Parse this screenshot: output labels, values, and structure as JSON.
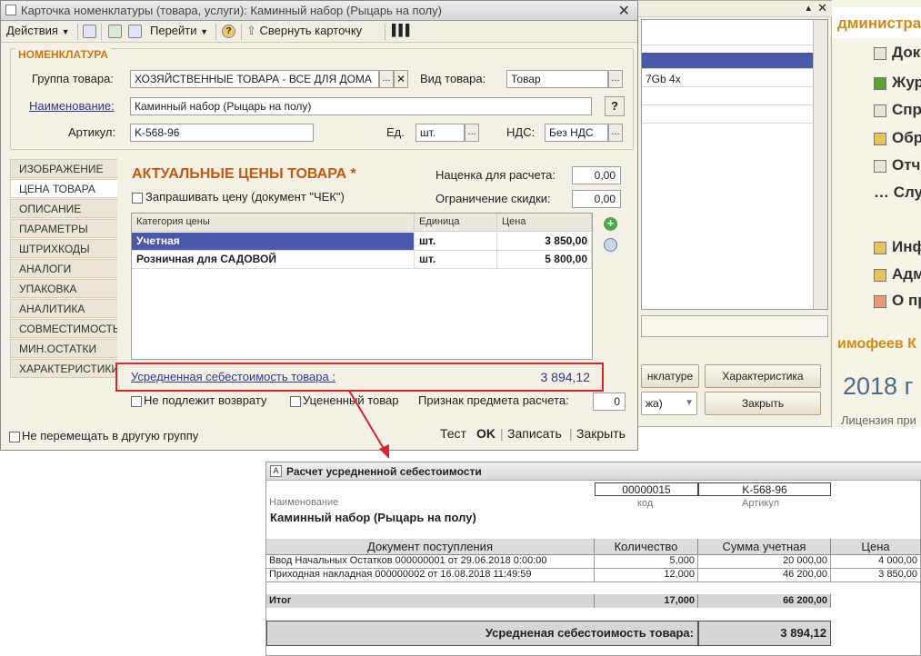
{
  "background_window": {
    "row_text": "7Gb 4x",
    "button_nomenclature": "нклатуре",
    "button_characteristic": "Характеристика",
    "combo_text": "жа)",
    "button_close": "Закрыть"
  },
  "right_strip": {
    "header": "дминистра",
    "items": [
      "Док",
      "Жур",
      "Спр",
      "Обр",
      "Отч",
      "Слу",
      "Инф",
      "Адм",
      "О пр"
    ],
    "user_name": "имофеев К",
    "year": "2018 г",
    "license": "Лицензия при"
  },
  "card": {
    "title": "Карточка номенклатуры (товара, услуги): Каминный набор (Рыцарь на полу)",
    "toolbar": {
      "actions": "Действия",
      "goto": "Перейти",
      "collapse": "Свернуть карточку"
    },
    "group_label": "НОМЕНКЛАТУРА",
    "fields": {
      "group_label": "Группа товара:",
      "group_value": "ХОЗЯЙСТВЕННЫЕ ТОВАРА - ВСЕ ДЛЯ ДОМА",
      "kind_label": "Вид товара:",
      "kind_value": "Товар",
      "name_label": "Наименование:",
      "name_value": "Каминный набор (Рыцарь на полу)",
      "article_label": "Артикул:",
      "article_value": "K-568-96",
      "unit_label": "Ед.",
      "unit_value": "шт.",
      "vat_label": "НДС:",
      "vat_value": "Без НДС",
      "help_btn": "?"
    },
    "tabs": [
      "ИЗОБРАЖЕНИЕ",
      "ЦЕНА ТОВАРА",
      "ОПИСАНИЕ",
      "ПАРАМЕТРЫ",
      "ШТРИХКОДЫ",
      "АНАЛОГИ",
      "УПАКОВКА",
      "АНАЛИТИКА",
      "СОВМЕСТИМОСТЬ",
      "МИН.ОСТАТКИ",
      "ХАРАКТЕРИСТИКИ"
    ],
    "prices": {
      "heading": "АКТУАЛЬНЫЕ ЦЕНЫ ТОВАРА *",
      "ask_price": "Запрашивать цену (документ \"ЧЕК\")",
      "markup_label": "Наценка для расчета:",
      "markup_value": "0,00",
      "discount_label": "Ограничение скидки:",
      "discount_value": "0,00",
      "columns": [
        "Категория цены",
        "Единица",
        "Цена"
      ],
      "rows": [
        {
          "category": "Учетная",
          "unit": "шт.",
          "price": "3 850,00"
        },
        {
          "category": "Розничная для САДОВОЙ",
          "unit": "шт.",
          "price": "5 800,00"
        }
      ],
      "avg_cost_label": "Усредненная себестоимость товара :",
      "avg_cost_value": "3 894,12"
    },
    "flags": {
      "non_returnable": "Не подлежит возврату",
      "discounted": "Уцененный товар",
      "subject_label": "Признак предмета расчета:",
      "subject_value": "0",
      "no_move_group": "Не перемещать в другую группу"
    },
    "footer": {
      "test": "Тест",
      "ok": "OK",
      "save": "Записать",
      "close": "Закрыть"
    }
  },
  "report": {
    "title": "Расчет усредненной себестоимости",
    "code_value": "00000015",
    "code_label": "код",
    "article_value": "K-568-96",
    "article_label": "Артикул",
    "name_label": "Наименование",
    "name_value": "Каминный набор (Рыцарь на полу)",
    "columns": [
      "Документ поступления",
      "Количество",
      "Сумма учетная",
      "Цена"
    ],
    "rows": [
      {
        "doc": "Ввод Начальных Остатков 000000001 от 29.06.2018 0:00:00",
        "qty": "5,000",
        "sum": "20 000,00",
        "price": "4 000,00"
      },
      {
        "doc": "Приходная накладная 000000002 от 16.08.2018 11:49:59",
        "qty": "12,000",
        "sum": "46 200,00",
        "price": "3 850,00"
      }
    ],
    "total_label": "Итог",
    "total_qty": "17,000",
    "total_sum": "66 200,00",
    "avg_label": "Усредненая себестоимость товара:",
    "avg_value": "3 894,12"
  },
  "colors": {
    "accent_orange": "#c97a10",
    "link_blue": "#2a3b8f",
    "selection": "#4a5aa8",
    "highlight_red": "#d8262b"
  }
}
